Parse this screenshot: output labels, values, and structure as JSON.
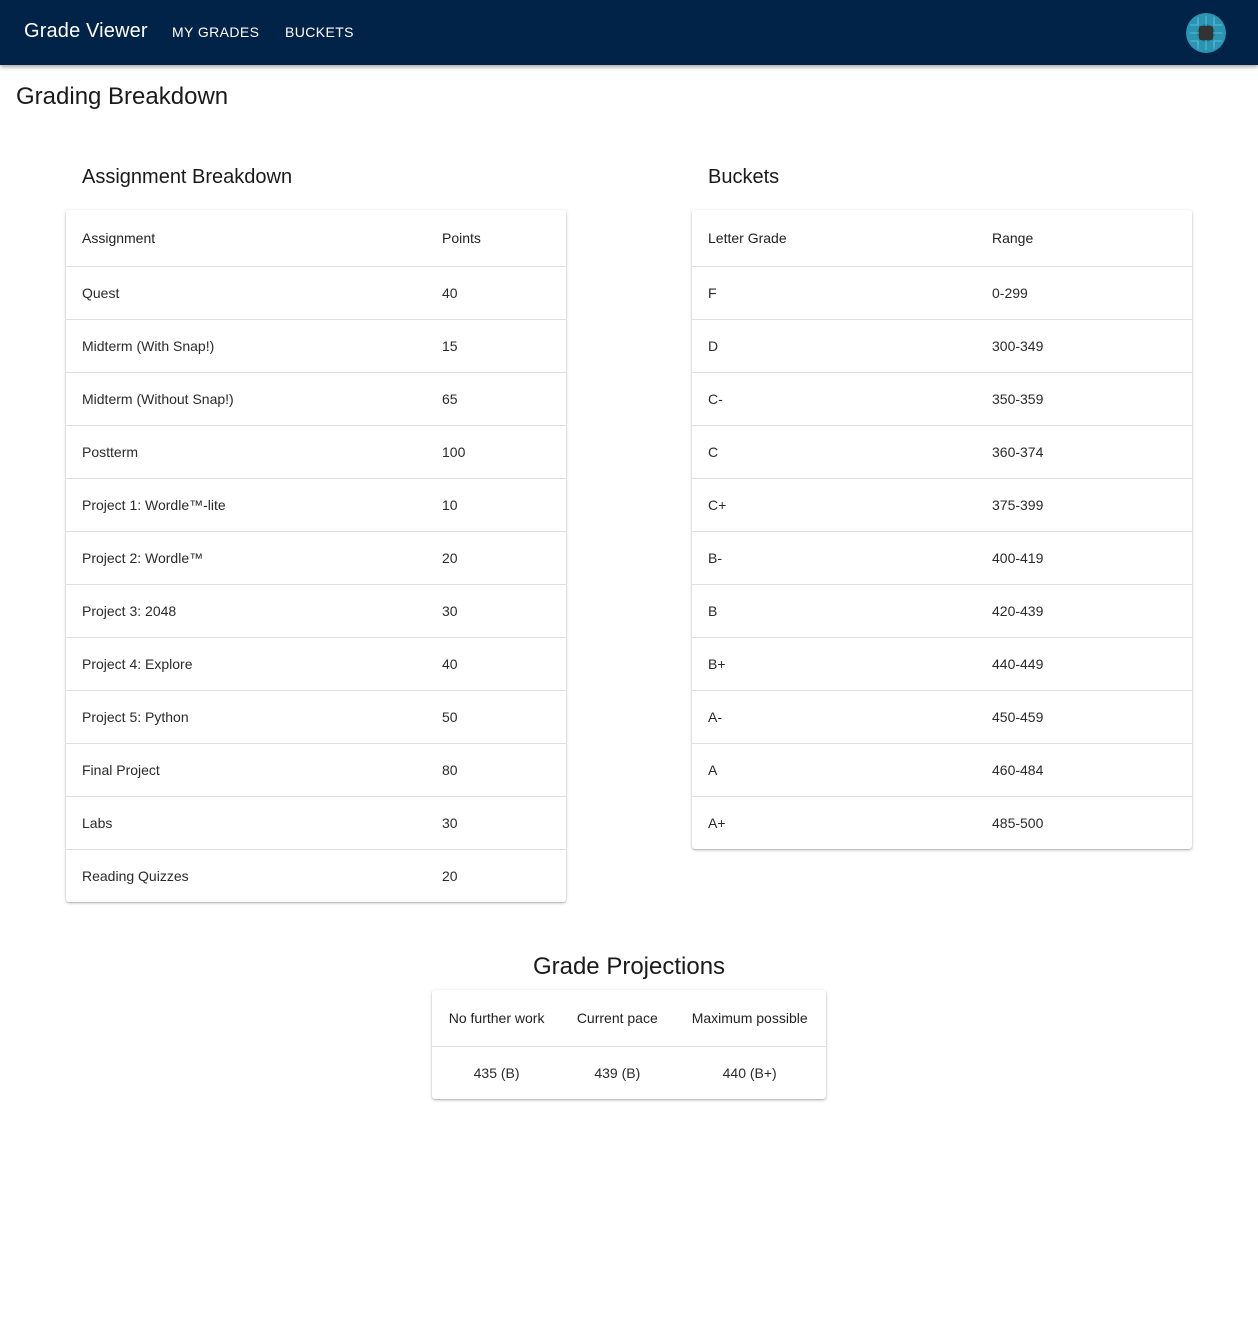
{
  "appbar": {
    "title": "Grade Viewer",
    "nav": [
      "MY GRADES",
      "BUCKETS"
    ],
    "color": "#012348"
  },
  "page": {
    "title": "Grading Breakdown"
  },
  "assignments": {
    "title": "Assignment Breakdown",
    "headers": [
      "Assignment",
      "Points"
    ],
    "rows": [
      [
        "Quest",
        "40"
      ],
      [
        "Midterm (With Snap!)",
        "15"
      ],
      [
        "Midterm (Without Snap!)",
        "65"
      ],
      [
        "Postterm",
        "100"
      ],
      [
        "Project 1: Wordle™-lite",
        "10"
      ],
      [
        "Project 2: Wordle™",
        "20"
      ],
      [
        "Project 3: 2048",
        "30"
      ],
      [
        "Project 4: Explore",
        "40"
      ],
      [
        "Project 5: Python",
        "50"
      ],
      [
        "Final Project",
        "80"
      ],
      [
        "Labs",
        "30"
      ],
      [
        "Reading Quizzes",
        "20"
      ]
    ]
  },
  "buckets": {
    "title": "Buckets",
    "headers": [
      "Letter Grade",
      "Range"
    ],
    "rows": [
      [
        "F",
        "0-299"
      ],
      [
        "D",
        "300-349"
      ],
      [
        "C-",
        "350-359"
      ],
      [
        "C",
        "360-374"
      ],
      [
        "C+",
        "375-399"
      ],
      [
        "B-",
        "400-419"
      ],
      [
        "B",
        "420-439"
      ],
      [
        "B+",
        "440-449"
      ],
      [
        "A-",
        "450-459"
      ],
      [
        "A",
        "460-484"
      ],
      [
        "A+",
        "485-500"
      ]
    ]
  },
  "projections": {
    "title": "Grade Projections",
    "headers": [
      "No further work",
      "Current pace",
      "Maximum possible"
    ],
    "values": [
      "435 (B)",
      "439 (B)",
      "440 (B+)"
    ]
  }
}
